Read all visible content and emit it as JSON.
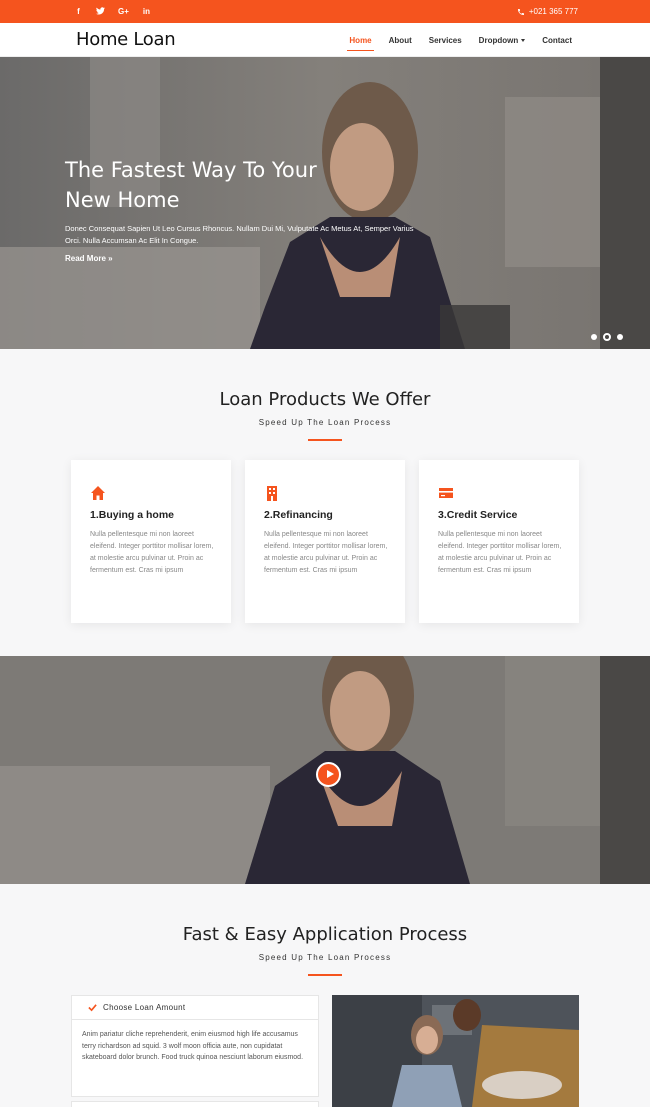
{
  "topbar": {
    "social": [
      {
        "icon": "facebook-icon",
        "glyph": "f"
      },
      {
        "icon": "twitter-icon",
        "glyph": "t"
      },
      {
        "icon": "google-plus-icon",
        "glyph": "G+"
      },
      {
        "icon": "linkedin-icon",
        "glyph": "in"
      }
    ],
    "phone": "+021 365 777"
  },
  "nav": {
    "brand": "Home Loan",
    "items": [
      {
        "label": "Home",
        "active": true
      },
      {
        "label": "About"
      },
      {
        "label": "Services"
      },
      {
        "label": "Dropdown"
      },
      {
        "label": "Contact"
      }
    ]
  },
  "hero": {
    "title": "The Fastest Way To Your New Home",
    "text": "Donec Consequat Sapien Ut Leo Cursus Rhoncus. Nullam Dui Mi, Vulputate Ac Metus At, Semper Varius Orci. Nulla Accumsan Ac Elit In Congue.",
    "read_more": "Read More »"
  },
  "products": {
    "title": "Loan Products We Offer",
    "subtitle": "Speed Up The Loan Process",
    "cards": [
      {
        "icon": "home-icon",
        "title": "1.Buying a home",
        "text": "Nulla pellentesque mi non laoreet eleifend. Integer porttitor mollisar lorem, at molestie arcu pulvinar ut. Proin ac fermentum est. Cras mi ipsum"
      },
      {
        "icon": "building-icon",
        "title": "2.Refinancing",
        "text": "Nulla pellentesque mi non laoreet eleifend. Integer porttitor mollisar lorem, at molestie arcu pulvinar ut. Proin ac fermentum est. Cras mi ipsum"
      },
      {
        "icon": "credit-card-icon",
        "title": "3.Credit Service",
        "text": "Nulla pellentesque mi non laoreet eleifend. Integer porttitor mollisar lorem, at molestie arcu pulvinar ut. Proin ac fermentum est. Cras mi ipsum"
      }
    ]
  },
  "process": {
    "title": "Fast & Easy Application Process",
    "subtitle": "Speed Up The Loan Process",
    "accordion": {
      "heading": "Choose Loan Amount",
      "body": "Anim pariatur cliche reprehenderit, enim eiusmod high life accusamus terry richardson ad squid. 3 wolf moon officia aute, non cupidatat skateboard dolor brunch. Food truck quinoa nesciunt laborum eiusmod."
    }
  },
  "colors": {
    "accent": "#f5541e"
  }
}
